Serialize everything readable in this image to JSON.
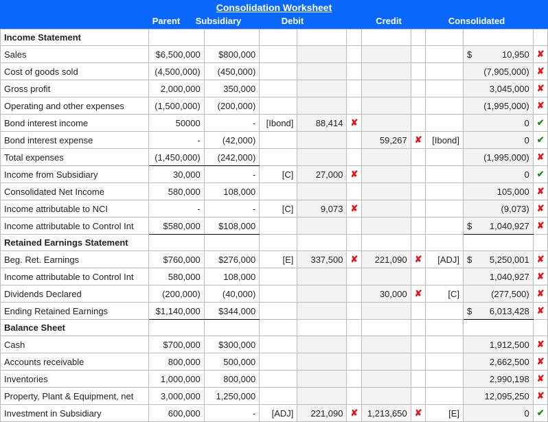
{
  "title": "Consolidation Worksheet",
  "headers": {
    "label": "",
    "parent": "Parent",
    "subsidiary": "Subsidiary",
    "debit": "Debit",
    "credit": "Credit",
    "consolidated": "Consolidated"
  },
  "marks": {
    "wrong": "✘",
    "correct": "✔"
  },
  "sections": [
    "Income Statement",
    "Retained Earnings Statement",
    "Balance Sheet"
  ],
  "rows": [
    {
      "type": "section",
      "label": "Income Statement"
    },
    {
      "label": "Sales",
      "parent": "$6,500,000",
      "sub": "$800,000",
      "ccur": "$",
      "cons": "10,950",
      "ok": "x"
    },
    {
      "label": "Cost of goods sold",
      "parent": "(4,500,000)",
      "sub": "(450,000)",
      "cons": "(7,905,000)",
      "ok": "x"
    },
    {
      "label": "Gross profit",
      "parent": "2,000,000",
      "sub": "350,000",
      "cons": "3,045,000",
      "ok": "x",
      "pclass": "bt",
      "sclass": "bt"
    },
    {
      "label": "Operating and other expenses",
      "parent": "(1,500,000)",
      "sub": "(200,000)",
      "cons": "(1,995,000)",
      "ok": "x"
    },
    {
      "label": "Bond interest income",
      "parent": "50000",
      "sub": "-",
      "dref": "[Ibond]",
      "dval": "88,414",
      "dmk": "x",
      "cons": "0",
      "ok": "c"
    },
    {
      "label": "Bond interest expense",
      "parent": "-",
      "sub": "(42,000)",
      "cval": "59,267",
      "cmk": "x",
      "cref": "[Ibond]",
      "cons": "0",
      "ok": "c"
    },
    {
      "label": "Total expenses",
      "parent": "(1,450,000)",
      "sub": "(242,000)",
      "cons": "(1,995,000)",
      "ok": "x",
      "pclass": "bt bb",
      "sclass": "bt bb"
    },
    {
      "label": "Income from Subsidiary",
      "parent": "30,000",
      "sub": "-",
      "dref": "[C]",
      "dval": "27,000",
      "dmk": "x",
      "cons": "0",
      "ok": "c"
    },
    {
      "label": "Consolidated Net Income",
      "parent": "580,000",
      "sub": "108,000",
      "cons": "105,000",
      "ok": "x"
    },
    {
      "label": "Income attributable to NCI",
      "parent": "-",
      "sub": "-",
      "dref": "[C]",
      "dval": "9,073",
      "dmk": "x",
      "cons": "(9,073)",
      "ok": "x"
    },
    {
      "label": "Income attributable to Control Int",
      "parent": "$580,000",
      "sub": "$108,000",
      "ccur": "$",
      "cons": "1,040,927",
      "ok": "x",
      "pclass": "bt bb",
      "sclass": "bt bb",
      "consclass": "bt bb"
    },
    {
      "type": "section",
      "label": "Retained Earnings Statement"
    },
    {
      "label": "Beg. Ret. Earnings",
      "parent": "$760,000",
      "sub": "$276,000",
      "dref": "[E]",
      "dval": "337,500",
      "dmk": "x",
      "cval": "221,090",
      "cmk": "x",
      "cref": "[ADJ]",
      "ccur": "$",
      "cons": "5,250,001",
      "ok": "x"
    },
    {
      "label": "Income attributable to Control Int",
      "parent": "580,000",
      "sub": "108,000",
      "cons": "1,040,927",
      "ok": "x"
    },
    {
      "label": "Dividends Declared",
      "parent": "(200,000)",
      "sub": "(40,000)",
      "cval": "30,000",
      "cmk": "x",
      "cref": "[C]",
      "cons": "(277,500)",
      "ok": "x"
    },
    {
      "label": "Ending Retained Earnings",
      "parent": "$1,140,000",
      "sub": "$344,000",
      "ccur": "$",
      "cons": "6,013,428",
      "ok": "x",
      "pclass": "bt bb",
      "sclass": "bt bb",
      "consclass": "bt bb"
    },
    {
      "type": "section",
      "label": "Balance Sheet"
    },
    {
      "label": "Cash",
      "parent": "$700,000",
      "sub": "$300,000",
      "cons": "1,912,500",
      "ok": "x"
    },
    {
      "label": "Accounts receivable",
      "parent": "800,000",
      "sub": "500,000",
      "cons": "2,662,500",
      "ok": "x"
    },
    {
      "label": "Inventories",
      "parent": "1,000,000",
      "sub": "800,000",
      "cons": "2,990,198",
      "ok": "x"
    },
    {
      "label": "Property, Plant & Equipment, net",
      "parent": "3,000,000",
      "sub": "1,250,000",
      "cons": "12,095,250",
      "ok": "x"
    },
    {
      "label": "Investment in Subsidiary",
      "parent": "600,000",
      "sub": "-",
      "dref": "[ADJ]",
      "dval": "221,090",
      "dmk": "x",
      "cval": "1,213,650",
      "cmk": "x",
      "cref": "[E]",
      "cons": "0",
      "ok": "c"
    }
  ]
}
